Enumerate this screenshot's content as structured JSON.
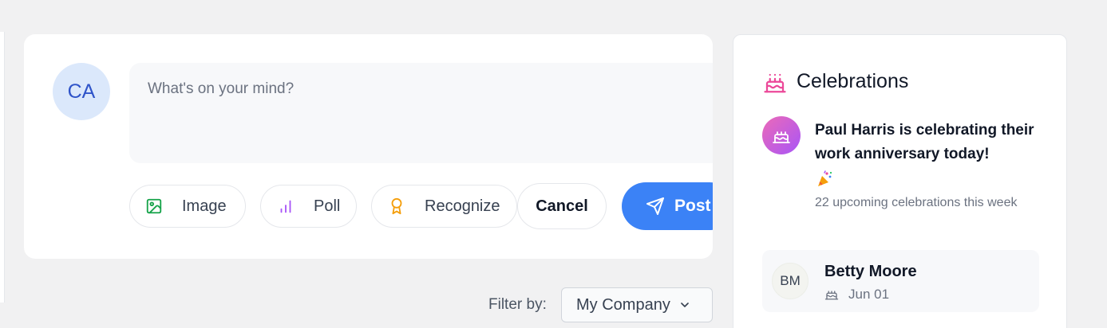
{
  "composer": {
    "avatar_initials": "CA",
    "placeholder": "What's on your mind?",
    "actions": {
      "image": "Image",
      "poll": "Poll",
      "recognize": "Recognize"
    },
    "cancel_label": "Cancel",
    "post_label": "Post"
  },
  "filter": {
    "label": "Filter by:",
    "selected": "My Company"
  },
  "celebrations": {
    "title": "Celebrations",
    "highlight": {
      "message": "Paul Harris is celebrating their work anniversary today!",
      "emoji": "party-popper"
    },
    "upcoming_text": "22 upcoming celebrations this week",
    "people": [
      {
        "initials": "BM",
        "name": "Betty Moore",
        "date": "Jun 01",
        "icon": "cake-icon"
      }
    ]
  },
  "colors": {
    "accent": "#3b82f6",
    "avatar_bg": "#dbe8fb",
    "cake_pink": "#ec4899",
    "image_green": "#16a34a",
    "poll_purple": "#a855f7",
    "recognize_orange": "#f59e0b"
  }
}
